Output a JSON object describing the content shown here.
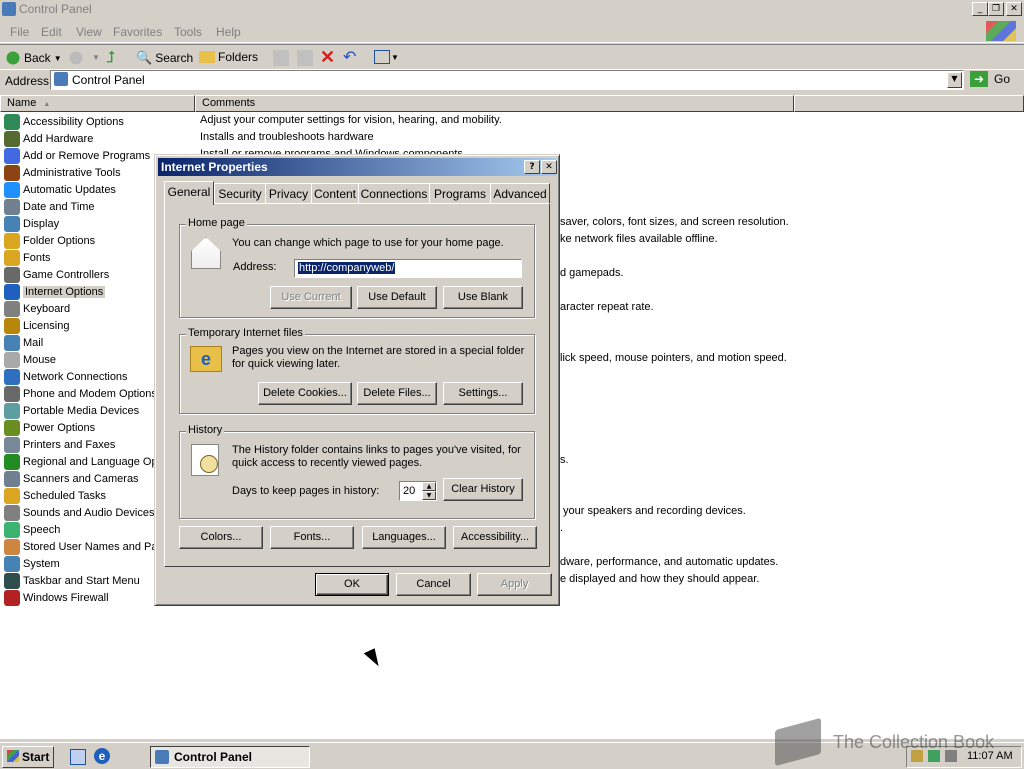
{
  "window": {
    "title": "Control Panel"
  },
  "menu": [
    "File",
    "Edit",
    "View",
    "Favorites",
    "Tools",
    "Help"
  ],
  "toolbar": {
    "back": "Back",
    "search": "Search",
    "folders": "Folders"
  },
  "address": {
    "label": "Address",
    "value": "Control Panel",
    "go": "Go"
  },
  "columns": {
    "name": "Name",
    "comments": "Comments"
  },
  "items": [
    {
      "name": "Accessibility Options",
      "color": "#2e8b57"
    },
    {
      "name": "Add Hardware",
      "color": "#556b2f"
    },
    {
      "name": "Add or Remove Programs",
      "color": "#4169e1"
    },
    {
      "name": "Administrative Tools",
      "color": "#8b4513"
    },
    {
      "name": "Automatic Updates",
      "color": "#1e90ff"
    },
    {
      "name": "Date and Time",
      "color": "#708090"
    },
    {
      "name": "Display",
      "color": "#4682b4"
    },
    {
      "name": "Folder Options",
      "color": "#daa520"
    },
    {
      "name": "Fonts",
      "color": "#daa520"
    },
    {
      "name": "Game Controllers",
      "color": "#696969"
    },
    {
      "name": "Internet Options",
      "color": "#1f5fbf"
    },
    {
      "name": "Keyboard",
      "color": "#808080"
    },
    {
      "name": "Licensing",
      "color": "#b8860b"
    },
    {
      "name": "Mail",
      "color": "#4682b4"
    },
    {
      "name": "Mouse",
      "color": "#a9a9a9"
    },
    {
      "name": "Network Connections",
      "color": "#2f6fbf"
    },
    {
      "name": "Phone and Modem Options",
      "color": "#696969"
    },
    {
      "name": "Portable Media Devices",
      "color": "#5f9ea0"
    },
    {
      "name": "Power Options",
      "color": "#6b8e23"
    },
    {
      "name": "Printers and Faxes",
      "color": "#778899"
    },
    {
      "name": "Regional and Language Opt",
      "color": "#228b22"
    },
    {
      "name": "Scanners and Cameras",
      "color": "#708090"
    },
    {
      "name": "Scheduled Tasks",
      "color": "#daa520"
    },
    {
      "name": "Sounds and Audio Devices",
      "color": "#808080"
    },
    {
      "name": "Speech",
      "color": "#3cb371"
    },
    {
      "name": "Stored User Names and Pas",
      "color": "#cd853f"
    },
    {
      "name": "System",
      "color": "#4682b4"
    },
    {
      "name": "Taskbar and Start Menu",
      "color": "#2f4f4f"
    },
    {
      "name": "Windows Firewall",
      "color": "#b22222"
    }
  ],
  "comments": {
    "accessibility": "Adjust your computer settings for vision, hearing, and mobility.",
    "hardware": "Installs and troubleshoots hardware",
    "add_remove": "Install or remove programs and Windows components.",
    "display": "saver, colors, font sizes, and screen resolution.",
    "folder": "ke network files available offline.",
    "game": "d gamepads.",
    "keyboard": "aracter repeat rate.",
    "mouse": "lick speed, mouse pointers, and motion speed.",
    "regional": "s.",
    "sounds": "your speakers and recording devices.",
    "stored": ".",
    "system": "dware, performance, and automatic updates.",
    "taskbar": "e displayed and how they should appear."
  },
  "dialog": {
    "title": "Internet Properties",
    "tabs": [
      "General",
      "Security",
      "Privacy",
      "Content",
      "Connections",
      "Programs",
      "Advanced"
    ],
    "home": {
      "group": "Home page",
      "text": "You can change which page to use for your home page.",
      "address_label": "Address:",
      "address_value": "http://companyweb/",
      "use_current": "Use Current",
      "use_default": "Use Default",
      "use_blank": "Use Blank"
    },
    "temp": {
      "group": "Temporary Internet files",
      "text1": "Pages you view on the Internet are stored in a special folder",
      "text2": "for quick viewing later.",
      "delete_cookies": "Delete Cookies...",
      "delete_files": "Delete Files...",
      "settings": "Settings..."
    },
    "history": {
      "group": "History",
      "text1": "The History folder contains links to pages you've visited, for",
      "text2": "quick access to recently viewed pages.",
      "days_label": "Days to keep pages in history:",
      "days_value": "20",
      "clear": "Clear History"
    },
    "bottom": {
      "colors": "Colors...",
      "fonts": "Fonts...",
      "languages": "Languages...",
      "accessibility": "Accessibility..."
    },
    "ok": "OK",
    "cancel": "Cancel",
    "apply": "Apply"
  },
  "taskbar": {
    "start": "Start",
    "task": "Control Panel",
    "clock": "11:07 AM"
  },
  "watermark": "The Collection Book"
}
